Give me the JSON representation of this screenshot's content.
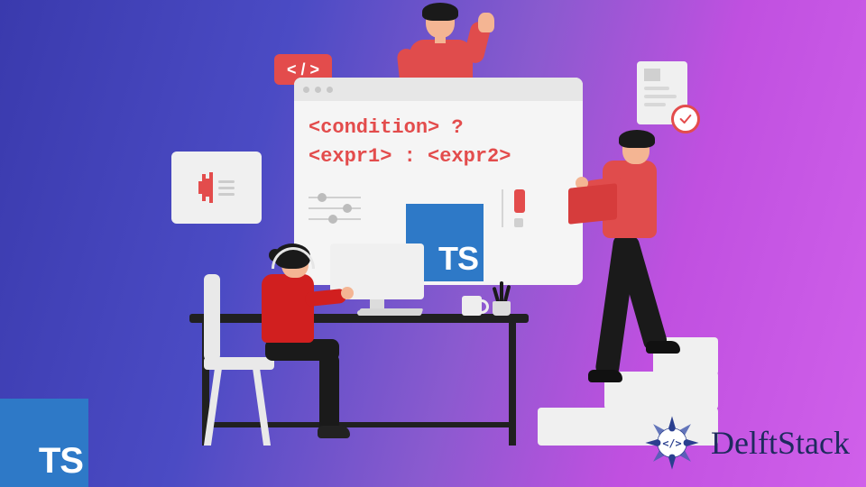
{
  "code": {
    "line1": "<condition> ?",
    "line2": "<expr1> : <expr2>"
  },
  "code_tag_label": "< / >",
  "ts_logo_text": "TS",
  "ts_badge_text": "TS",
  "brand_name": "DelftStack",
  "icons": {
    "code_tag": "code-tag-icon",
    "check": "checkmark-icon",
    "brand_emblem": "delftstack-emblem"
  },
  "colors": {
    "accent_red": "#e34c4c",
    "ts_blue": "#2e79c7",
    "panel_gray": "#f0f0f0",
    "brand_text": "#1e2a5e"
  }
}
